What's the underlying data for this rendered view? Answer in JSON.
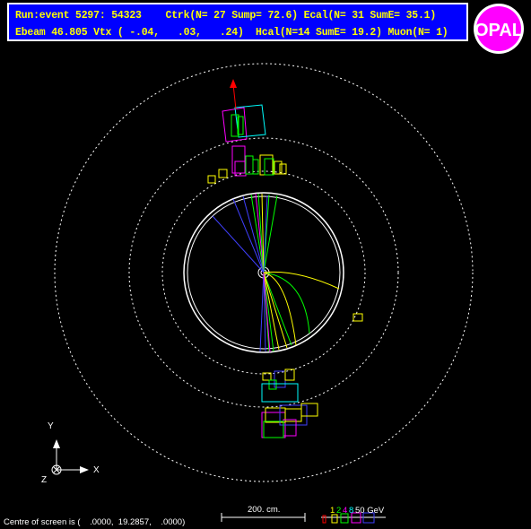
{
  "header": {
    "line1": "Run:event 5297: 54323    Ctrk(N= 27 Sump= 72.6) Ecal(N= 31 SumE= 35.1)",
    "line2": "Ebeam 46.805 Vtx ( -.04,   .03,   .24)  Hcal(N=14 SumE= 19.2) Muon(N= 1)"
  },
  "logo": {
    "text": "OPAL"
  },
  "axes": {
    "y": "Y",
    "x": "X",
    "z": "Z"
  },
  "footer": {
    "centre": "Centre of screen is (    .0000,  19.2857,    .0000)",
    "scale": "200. cm.",
    "energy_scale": [
      {
        "label": "1",
        "color": "#ffff00"
      },
      {
        "label": "2",
        "color": "#00ff00"
      },
      {
        "label": "4",
        "color": "#ff00ff"
      },
      {
        "label": "8",
        "color": "#00ffff"
      },
      {
        "label": "50 GeV",
        "color": "#ffffff"
      }
    ]
  },
  "colors": {
    "header_bg": "#0000ff",
    "header_text": "#ffff00",
    "track_green": "#00ff00",
    "track_yellow": "#ffff00",
    "track_blue": "#4040ff",
    "track_magenta": "#ff00ff",
    "muon_arrow": "#ff0000"
  }
}
